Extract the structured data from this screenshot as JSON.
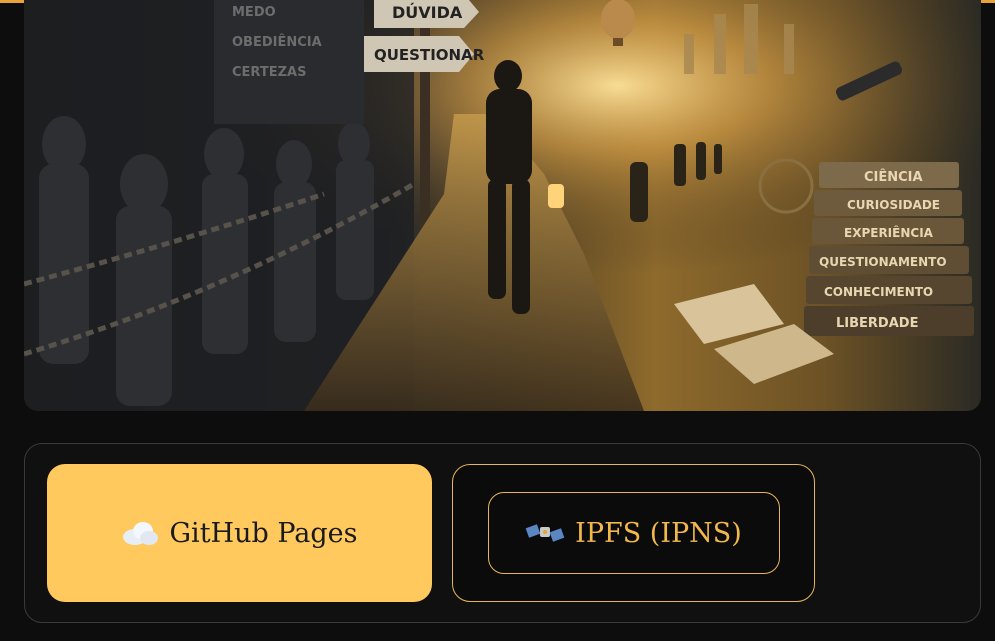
{
  "hero": {
    "left_sign_words": [
      "MEDO",
      "OBEDIÊNCIA",
      "CERTEZAS"
    ],
    "signpost": [
      "DÚVIDA",
      "QUESTIONAR"
    ],
    "books": [
      "CIÊNCIA",
      "CURIOSIDADE",
      "EXPERIÊNCIA",
      "QUESTIONAMENTO",
      "CONHECIMENTO",
      "LIBERDADE"
    ]
  },
  "tabs": [
    {
      "label": "GitHub Pages",
      "icon": "cloud-icon",
      "active": true
    },
    {
      "label": "IPFS (IPNS)",
      "icon": "satellite-icon",
      "active": false
    }
  ],
  "colors": {
    "accent": "#ffc95e",
    "accent_border": "#e8b65a",
    "background": "#0d0d0d"
  }
}
